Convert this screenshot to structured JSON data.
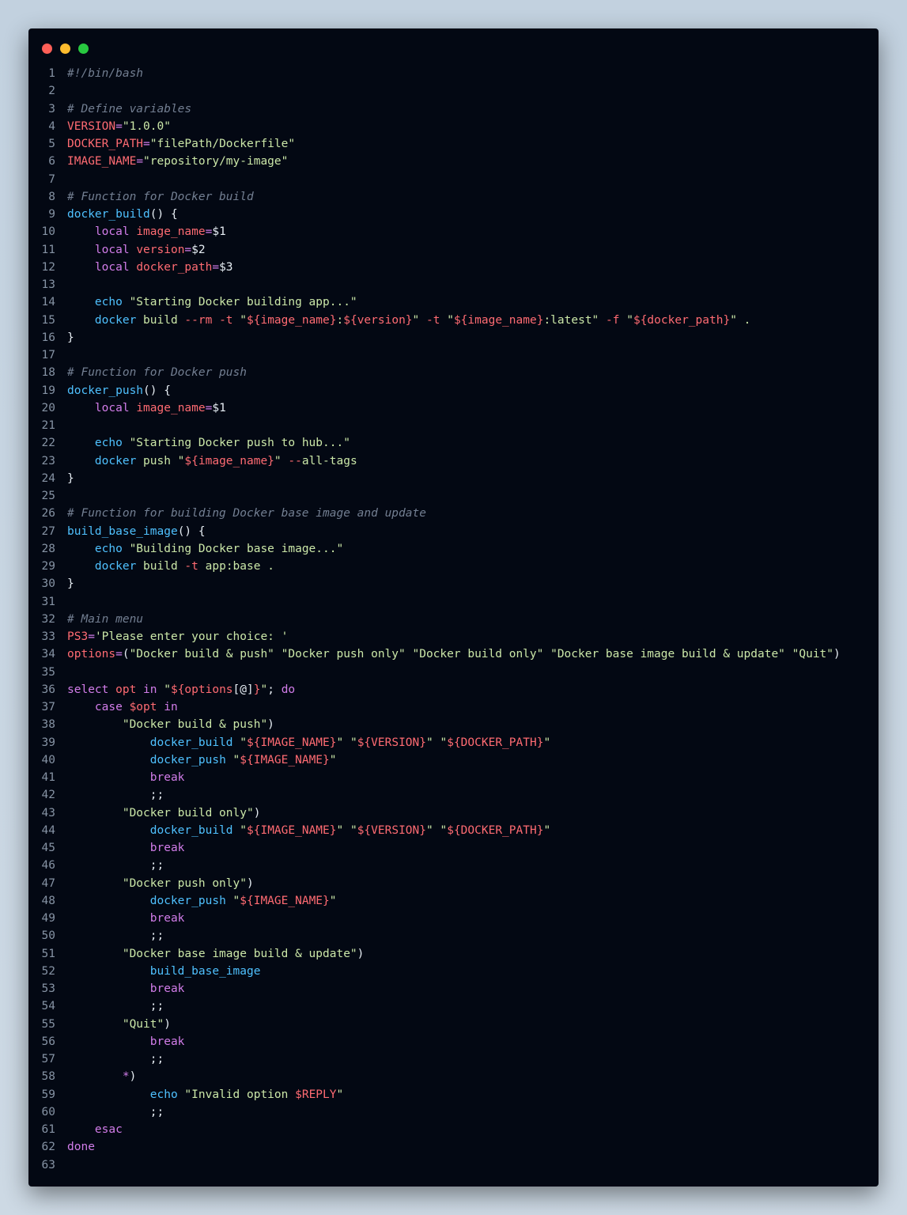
{
  "window": {
    "controls": [
      "close",
      "minimize",
      "maximize"
    ],
    "colors": {
      "background": "#030813",
      "close": "#fe5f57",
      "minimize": "#febc2e",
      "maximize": "#28c840"
    }
  },
  "editor": {
    "language": "bash",
    "token_colors": {
      "comment": "#737f92",
      "variable": "#ff6b72",
      "string": "#cbe7a8",
      "function": "#4fc1ff",
      "keyword": "#d27dea",
      "text": "#e6edf3"
    },
    "lines": [
      {
        "n": "1",
        "tokens": [
          [
            "c",
            "#!/bin/bash"
          ]
        ]
      },
      {
        "n": "2",
        "tokens": []
      },
      {
        "n": "3",
        "tokens": [
          [
            "c",
            "# Define variables"
          ]
        ]
      },
      {
        "n": "4",
        "tokens": [
          [
            "v",
            "VERSION"
          ],
          [
            "k",
            "="
          ],
          [
            "s",
            "\"1.0.0\""
          ]
        ]
      },
      {
        "n": "5",
        "tokens": [
          [
            "v",
            "DOCKER_PATH"
          ],
          [
            "k",
            "="
          ],
          [
            "s",
            "\"filePath/Dockerfile\""
          ]
        ]
      },
      {
        "n": "6",
        "tokens": [
          [
            "v",
            "IMAGE_NAME"
          ],
          [
            "k",
            "="
          ],
          [
            "s",
            "\"repository/my-image\""
          ]
        ]
      },
      {
        "n": "7",
        "tokens": []
      },
      {
        "n": "8",
        "tokens": [
          [
            "c",
            "# Function for Docker build"
          ]
        ]
      },
      {
        "n": "9",
        "tokens": [
          [
            "f",
            "docker_build"
          ],
          [
            "o",
            "() {"
          ]
        ]
      },
      {
        "n": "10",
        "tokens": [
          [
            "t",
            "    "
          ],
          [
            "k",
            "local "
          ],
          [
            "v",
            "image_name"
          ],
          [
            "k",
            "="
          ],
          [
            "t",
            "$1"
          ]
        ]
      },
      {
        "n": "11",
        "tokens": [
          [
            "t",
            "    "
          ],
          [
            "k",
            "local "
          ],
          [
            "v",
            "version"
          ],
          [
            "k",
            "="
          ],
          [
            "t",
            "$2"
          ]
        ]
      },
      {
        "n": "12",
        "tokens": [
          [
            "t",
            "    "
          ],
          [
            "k",
            "local "
          ],
          [
            "v",
            "docker_path"
          ],
          [
            "k",
            "="
          ],
          [
            "t",
            "$3"
          ]
        ]
      },
      {
        "n": "13",
        "tokens": []
      },
      {
        "n": "14",
        "tokens": [
          [
            "t",
            "    "
          ],
          [
            "f",
            "echo "
          ],
          [
            "s",
            "\"Starting Docker building app...\""
          ]
        ]
      },
      {
        "n": "15",
        "tokens": [
          [
            "t",
            "    "
          ],
          [
            "f",
            "docker "
          ],
          [
            "s",
            "build "
          ],
          [
            "v",
            "--rm -t "
          ],
          [
            "s",
            "\""
          ],
          [
            "v",
            "${image_name}"
          ],
          [
            "s",
            ":"
          ],
          [
            "v",
            "${version}"
          ],
          [
            "s",
            "\" "
          ],
          [
            "v",
            "-t "
          ],
          [
            "s",
            "\""
          ],
          [
            "v",
            "${image_name}"
          ],
          [
            "s",
            ":latest\" "
          ],
          [
            "v",
            "-f "
          ],
          [
            "s",
            "\""
          ],
          [
            "v",
            "${docker_path}"
          ],
          [
            "s",
            "\" ."
          ]
        ]
      },
      {
        "n": "16",
        "tokens": [
          [
            "o",
            "}"
          ]
        ]
      },
      {
        "n": "17",
        "tokens": []
      },
      {
        "n": "18",
        "tokens": [
          [
            "c",
            "# Function for Docker push"
          ]
        ]
      },
      {
        "n": "19",
        "tokens": [
          [
            "f",
            "docker_push"
          ],
          [
            "o",
            "() {"
          ]
        ]
      },
      {
        "n": "20",
        "tokens": [
          [
            "t",
            "    "
          ],
          [
            "k",
            "local "
          ],
          [
            "v",
            "image_name"
          ],
          [
            "k",
            "="
          ],
          [
            "t",
            "$1"
          ]
        ]
      },
      {
        "n": "21",
        "tokens": []
      },
      {
        "n": "22",
        "tokens": [
          [
            "t",
            "    "
          ],
          [
            "f",
            "echo "
          ],
          [
            "s",
            "\"Starting Docker push to hub...\""
          ]
        ]
      },
      {
        "n": "23",
        "tokens": [
          [
            "t",
            "    "
          ],
          [
            "f",
            "docker "
          ],
          [
            "s",
            "push \""
          ],
          [
            "v",
            "${image_name}"
          ],
          [
            "s",
            "\" "
          ],
          [
            "v",
            "--"
          ],
          [
            "s",
            "all-tags"
          ]
        ]
      },
      {
        "n": "24",
        "tokens": [
          [
            "o",
            "}"
          ]
        ]
      },
      {
        "n": "25",
        "tokens": []
      },
      {
        "n": "26",
        "tokens": [
          [
            "c",
            "# Function for building Docker base image and update"
          ]
        ]
      },
      {
        "n": "27",
        "tokens": [
          [
            "f",
            "build_base_image"
          ],
          [
            "o",
            "() {"
          ]
        ]
      },
      {
        "n": "28",
        "tokens": [
          [
            "t",
            "    "
          ],
          [
            "f",
            "echo "
          ],
          [
            "s",
            "\"Building Docker base image...\""
          ]
        ]
      },
      {
        "n": "29",
        "tokens": [
          [
            "t",
            "    "
          ],
          [
            "f",
            "docker "
          ],
          [
            "s",
            "build "
          ],
          [
            "v",
            "-t "
          ],
          [
            "s",
            "app:base ."
          ]
        ]
      },
      {
        "n": "30",
        "tokens": [
          [
            "o",
            "}"
          ]
        ]
      },
      {
        "n": "31",
        "tokens": []
      },
      {
        "n": "32",
        "tokens": [
          [
            "c",
            "# Main menu"
          ]
        ]
      },
      {
        "n": "33",
        "tokens": [
          [
            "v",
            "PS3"
          ],
          [
            "k",
            "="
          ],
          [
            "s",
            "'Please enter your choice: '"
          ]
        ]
      },
      {
        "n": "34",
        "tokens": [
          [
            "v",
            "options"
          ],
          [
            "k",
            "="
          ],
          [
            "o",
            "("
          ],
          [
            "s",
            "\"Docker build & push\" \"Docker push only\" \"Docker build only\" \"Docker base image build & update\" \"Quit\""
          ],
          [
            "o",
            ")"
          ]
        ]
      },
      {
        "n": "35",
        "tokens": []
      },
      {
        "n": "36",
        "tokens": [
          [
            "k",
            "select "
          ],
          [
            "v",
            "opt "
          ],
          [
            "k",
            "in "
          ],
          [
            "s",
            "\""
          ],
          [
            "v",
            "${options"
          ],
          [
            "o",
            "[@]"
          ],
          [
            "v",
            "}"
          ],
          [
            "s",
            "\""
          ],
          [
            "o",
            "; "
          ],
          [
            "k",
            "do"
          ]
        ]
      },
      {
        "n": "37",
        "tokens": [
          [
            "t",
            "    "
          ],
          [
            "k",
            "case "
          ],
          [
            "v",
            "$opt "
          ],
          [
            "k",
            "in"
          ]
        ]
      },
      {
        "n": "38",
        "tokens": [
          [
            "t",
            "        "
          ],
          [
            "s",
            "\"Docker build & push\""
          ],
          [
            "o",
            ")"
          ]
        ]
      },
      {
        "n": "39",
        "tokens": [
          [
            "t",
            "            "
          ],
          [
            "f",
            "docker_build "
          ],
          [
            "s",
            "\""
          ],
          [
            "v",
            "${IMAGE_NAME}"
          ],
          [
            "s",
            "\" \""
          ],
          [
            "v",
            "${VERSION}"
          ],
          [
            "s",
            "\" \""
          ],
          [
            "v",
            "${DOCKER_PATH}"
          ],
          [
            "s",
            "\""
          ]
        ]
      },
      {
        "n": "40",
        "tokens": [
          [
            "t",
            "            "
          ],
          [
            "f",
            "docker_push "
          ],
          [
            "s",
            "\""
          ],
          [
            "v",
            "${IMAGE_NAME}"
          ],
          [
            "s",
            "\""
          ]
        ]
      },
      {
        "n": "41",
        "tokens": [
          [
            "t",
            "            "
          ],
          [
            "k",
            "break"
          ]
        ]
      },
      {
        "n": "42",
        "tokens": [
          [
            "t",
            "            "
          ],
          [
            "o",
            ";;"
          ]
        ]
      },
      {
        "n": "43",
        "tokens": [
          [
            "t",
            "        "
          ],
          [
            "s",
            "\"Docker build only\""
          ],
          [
            "o",
            ")"
          ]
        ]
      },
      {
        "n": "44",
        "tokens": [
          [
            "t",
            "            "
          ],
          [
            "f",
            "docker_build "
          ],
          [
            "s",
            "\""
          ],
          [
            "v",
            "${IMAGE_NAME}"
          ],
          [
            "s",
            "\" \""
          ],
          [
            "v",
            "${VERSION}"
          ],
          [
            "s",
            "\" \""
          ],
          [
            "v",
            "${DOCKER_PATH}"
          ],
          [
            "s",
            "\""
          ]
        ]
      },
      {
        "n": "45",
        "tokens": [
          [
            "t",
            "            "
          ],
          [
            "k",
            "break"
          ]
        ]
      },
      {
        "n": "46",
        "tokens": [
          [
            "t",
            "            "
          ],
          [
            "o",
            ";;"
          ]
        ]
      },
      {
        "n": "47",
        "tokens": [
          [
            "t",
            "        "
          ],
          [
            "s",
            "\"Docker push only\""
          ],
          [
            "o",
            ")"
          ]
        ]
      },
      {
        "n": "48",
        "tokens": [
          [
            "t",
            "            "
          ],
          [
            "f",
            "docker_push "
          ],
          [
            "s",
            "\""
          ],
          [
            "v",
            "${IMAGE_NAME}"
          ],
          [
            "s",
            "\""
          ]
        ]
      },
      {
        "n": "49",
        "tokens": [
          [
            "t",
            "            "
          ],
          [
            "k",
            "break"
          ]
        ]
      },
      {
        "n": "50",
        "tokens": [
          [
            "t",
            "            "
          ],
          [
            "o",
            ";;"
          ]
        ]
      },
      {
        "n": "51",
        "tokens": [
          [
            "t",
            "        "
          ],
          [
            "s",
            "\"Docker base image build & update\""
          ],
          [
            "o",
            ")"
          ]
        ]
      },
      {
        "n": "52",
        "tokens": [
          [
            "t",
            "            "
          ],
          [
            "f",
            "build_base_image"
          ]
        ]
      },
      {
        "n": "53",
        "tokens": [
          [
            "t",
            "            "
          ],
          [
            "k",
            "break"
          ]
        ]
      },
      {
        "n": "54",
        "tokens": [
          [
            "t",
            "            "
          ],
          [
            "o",
            ";;"
          ]
        ]
      },
      {
        "n": "55",
        "tokens": [
          [
            "t",
            "        "
          ],
          [
            "s",
            "\"Quit\""
          ],
          [
            "o",
            ")"
          ]
        ]
      },
      {
        "n": "56",
        "tokens": [
          [
            "t",
            "            "
          ],
          [
            "k",
            "break"
          ]
        ]
      },
      {
        "n": "57",
        "tokens": [
          [
            "t",
            "            "
          ],
          [
            "o",
            ";;"
          ]
        ]
      },
      {
        "n": "58",
        "tokens": [
          [
            "t",
            "        "
          ],
          [
            "k",
            "*"
          ],
          [
            "o",
            ")"
          ]
        ]
      },
      {
        "n": "59",
        "tokens": [
          [
            "t",
            "            "
          ],
          [
            "f",
            "echo "
          ],
          [
            "s",
            "\"Invalid option "
          ],
          [
            "v",
            "$REPLY"
          ],
          [
            "s",
            "\""
          ]
        ]
      },
      {
        "n": "60",
        "tokens": [
          [
            "t",
            "            "
          ],
          [
            "o",
            ";;"
          ]
        ]
      },
      {
        "n": "61",
        "tokens": [
          [
            "t",
            "    "
          ],
          [
            "k",
            "esac"
          ]
        ]
      },
      {
        "n": "62",
        "tokens": [
          [
            "k",
            "done"
          ]
        ]
      },
      {
        "n": "63",
        "tokens": []
      }
    ]
  }
}
